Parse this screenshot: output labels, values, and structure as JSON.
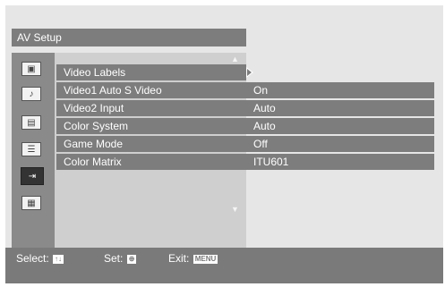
{
  "menu": {
    "title": "AV Setup",
    "rows": [
      {
        "label": "Video Labels",
        "value": ""
      },
      {
        "label": "Video1 Auto S Video",
        "value": "On"
      },
      {
        "label": "Video2 Input",
        "value": "Auto"
      },
      {
        "label": "Color System",
        "value": "Auto"
      },
      {
        "label": "Game Mode",
        "value": "Off"
      },
      {
        "label": "Color Matrix",
        "value": "ITU601"
      }
    ]
  },
  "sidebar": {
    "icons": [
      "picture-icon",
      "sound-icon",
      "screen-icon",
      "setup-icon",
      "av-setup-icon",
      "pc-icon"
    ],
    "selected": "av-setup-icon"
  },
  "footer": {
    "select_label": "Select:",
    "select_keys": "↑↓",
    "set_label": "Set:",
    "set_key": "⊕",
    "exit_label": "Exit:",
    "exit_key": "MENU"
  }
}
